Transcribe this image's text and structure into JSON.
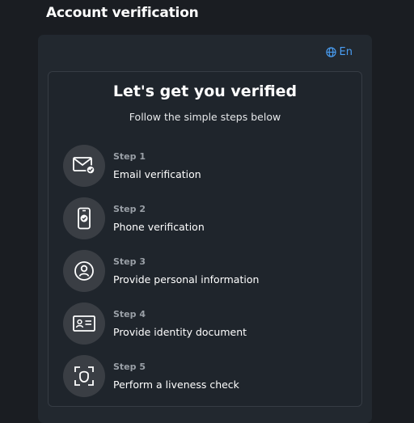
{
  "header": {
    "title": "Account verification"
  },
  "language": {
    "label": "En",
    "icon": "globe-icon"
  },
  "verification": {
    "heading": "Let's get you verified",
    "subheading": "Follow the simple steps below",
    "steps": [
      {
        "step": "Step 1",
        "label": "Email verification",
        "icon": "email-check-icon"
      },
      {
        "step": "Step 2",
        "label": "Phone verification",
        "icon": "phone-check-icon"
      },
      {
        "step": "Step 3",
        "label": "Provide personal information",
        "icon": "person-icon"
      },
      {
        "step": "Step 4",
        "label": "Provide identity document",
        "icon": "id-card-icon"
      },
      {
        "step": "Step 5",
        "label": "Perform a liveness check",
        "icon": "face-scan-icon"
      }
    ]
  },
  "colors": {
    "accent": "#4a9ff5",
    "background": "#1a1d22",
    "card": "#22282f"
  }
}
